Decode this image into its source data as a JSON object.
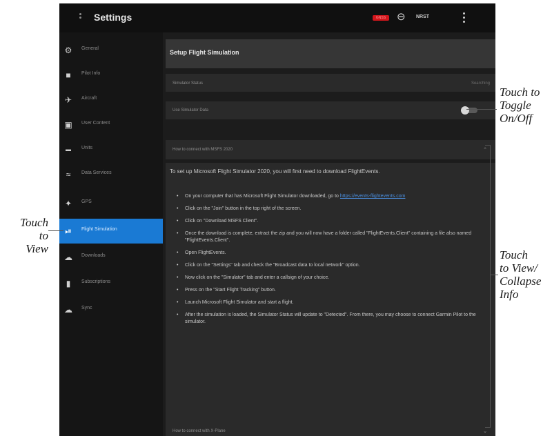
{
  "app": {
    "title": "Settings",
    "status_badge": "GNSS",
    "signal_text": "NRST"
  },
  "sidebar": {
    "items": [
      {
        "label": "General",
        "icon": "gear-icon",
        "active": false
      },
      {
        "label": "Pilot Info",
        "icon": "person-icon",
        "active": false
      },
      {
        "label": "Aircraft",
        "icon": "airplane-icon",
        "active": false
      },
      {
        "label": "User Content",
        "icon": "content-icon",
        "active": false
      },
      {
        "label": "Units",
        "icon": "ruler-icon",
        "active": false
      },
      {
        "label": "Data Services",
        "icon": "wifi-icon",
        "active": false
      },
      {
        "label": "GPS",
        "icon": "satellite-icon",
        "active": false
      },
      {
        "label": "Flight Simulation",
        "icon": "joystick-icon",
        "active": true
      },
      {
        "label": "Downloads",
        "icon": "download-cloud-icon",
        "active": false
      },
      {
        "label": "Subscriptions",
        "icon": "lock-icon",
        "active": false
      },
      {
        "label": "Sync",
        "icon": "sync-cloud-icon",
        "active": false
      }
    ]
  },
  "main": {
    "section_title": "Setup Flight Simulation",
    "simulator_status_label": "Simulator Status",
    "simulator_status_value": "Searching",
    "use_simulator_data_label": "Use Simulator Data",
    "use_simulator_data_on": true,
    "msfs_header": "How to connect with MSFS 2020",
    "intro": "To set up Microsoft Flight Simulator 2020, you will first need to download FlightEvents.",
    "steps": [
      "On your computer that has Microsoft Flight Simulator downloaded, go to https://events-flightevents.com",
      "Click on the \"Join\" button in the top right of the screen.",
      "Click on \"Download MSFS Client\".",
      "Once the download is complete, extract the zip and you will now have a folder called \"FlightEvents.Client\" containing a file also named \"FlightEvents.Client\".",
      "Open FlightEvents.",
      "Click on the \"Settings\" tab and check the \"Broadcast data to local network\" option.",
      "Now click on the \"Simulator\" tab and enter a callsign of your choice.",
      "Press on the \"Start Flight Tracking\" button.",
      "Launch Microsoft Flight Simulator and start a flight.",
      "After the simulation is loaded, the Simulator Status will update to \"Detected\". From there, you may choose to connect Garmin Pilot to the simulator."
    ],
    "xplane_header": "How to connect with X-Plane"
  },
  "annotations": {
    "toggle": [
      "Touch to",
      "Toggle",
      "On/Off"
    ],
    "view": [
      "Touch",
      "to View"
    ],
    "collapse": [
      "Touch",
      "to View/",
      "Collapse",
      "Info"
    ]
  },
  "colors": {
    "accent": "#1a7ad4",
    "status_badge": "#d2161c",
    "background": "#1c1c1c",
    "panel": "#2a2a2a"
  }
}
